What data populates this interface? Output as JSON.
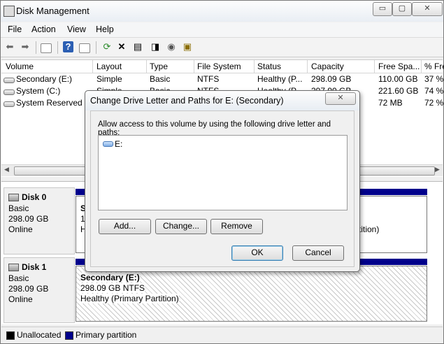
{
  "window": {
    "title": "Disk Management",
    "buttons": {
      "minimize": "▭",
      "maximize": "▢",
      "close": "✕"
    }
  },
  "menu": [
    "File",
    "Action",
    "View",
    "Help"
  ],
  "toolbar": {
    "icons": [
      "back-arrow-icon",
      "forward-arrow-icon",
      "console-tree-icon",
      "help-icon",
      "details-view-icon",
      "refresh-icon",
      "delete-icon",
      "properties-icon",
      "rescan-icon",
      "settings-icon"
    ]
  },
  "volumes": {
    "columns": [
      "Volume",
      "Layout",
      "Type",
      "File System",
      "Status",
      "Capacity",
      "Free Spa...",
      "% Fre"
    ],
    "rows": [
      {
        "volume": "Secondary (E:)",
        "layout": "Simple",
        "type": "Basic",
        "fs": "NTFS",
        "status": "Healthy (P...",
        "capacity": "298.09 GB",
        "free": "110.00 GB",
        "pct": "37 %"
      },
      {
        "volume": "System (C:)",
        "layout": "Simple",
        "type": "Basic",
        "fs": "NTFS",
        "status": "Healthy (P...",
        "capacity": "297.90 GB",
        "free": "221.60 GB",
        "pct": "74 %"
      },
      {
        "volume": "System Reserved",
        "layout": "",
        "type": "",
        "fs": "",
        "status": "",
        "capacity": "",
        "free": "72 MB",
        "pct": "72 %"
      }
    ]
  },
  "disks": [
    {
      "title": "Disk 0",
      "type": "Basic",
      "size": "298.09 GB",
      "state": "Online",
      "partition": {
        "name": "Se",
        "line2": "1",
        "line3": "H",
        "tail": "rtition)"
      }
    },
    {
      "title": "Disk 1",
      "type": "Basic",
      "size": "298.09 GB",
      "state": "Online",
      "partition": {
        "name": "Secondary  (E:)",
        "line2": "298.09 GB NTFS",
        "line3": "Healthy (Primary Partition)"
      }
    }
  ],
  "legend": [
    {
      "label": "Unallocated",
      "color": "#000000"
    },
    {
      "label": "Primary partition",
      "color": "#00008b"
    }
  ],
  "dialog": {
    "title": "Change Drive Letter and Paths for E: (Secondary)",
    "close": "✕",
    "instruction": "Allow access to this volume by using the following drive letter and paths:",
    "entries": [
      "E:"
    ],
    "buttons": {
      "add": "Add...",
      "change": "Change...",
      "remove": "Remove",
      "ok": "OK",
      "cancel": "Cancel"
    }
  }
}
